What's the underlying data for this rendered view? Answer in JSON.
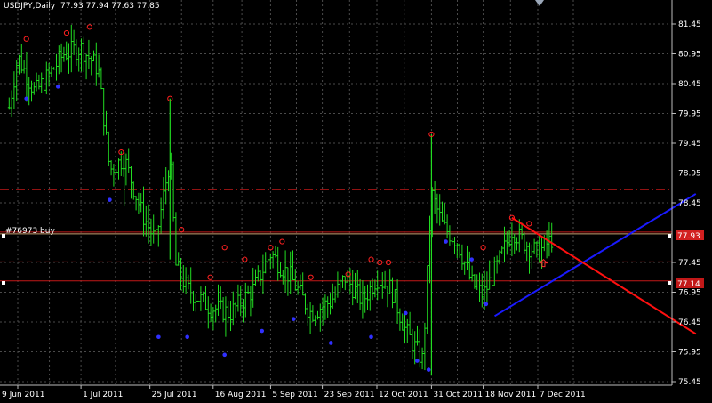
{
  "header": {
    "symbol_timeframe": "USDJPY,Daily",
    "ohlc": "77.93 77.94 77.63 77.85"
  },
  "order_label": "#76973 buy",
  "price_tags": {
    "upper": "77.93",
    "lower": "77.14"
  },
  "y_axis_labels": [
    "81.45",
    "80.95",
    "80.45",
    "79.95",
    "79.45",
    "78.95",
    "78.45",
    "77.45",
    "76.95",
    "76.45",
    "75.95",
    "75.45"
  ],
  "x_axis_labels": [
    "9 Jun 2011",
    "1 Jul 2011",
    "25 Jul 2011",
    "16 Aug 2011",
    "5 Sep 2011",
    "23 Sep 2011",
    "12 Oct 2011",
    "31 Oct 2011",
    "18 Nov 2011",
    "7 Dec 2011"
  ],
  "colors": {
    "background": "#000000",
    "bars": "#22dd22",
    "grid": "#4a4a4a",
    "fractal_high": "#ff2020",
    "fractal_low": "#3030ff",
    "trend_up": "#1a1aff",
    "trend_down": "#ff1010",
    "order_line": "#d22020",
    "sl_tp_line": "#c21818"
  },
  "chart_data": {
    "type": "ohlc",
    "y_axis_labels": [
      81.45,
      80.95,
      80.45,
      79.95,
      79.45,
      78.95,
      78.45,
      77.45,
      76.95,
      76.45,
      75.95,
      75.45
    ],
    "ylim": [
      75.37,
      81.62
    ],
    "close_path": [
      {
        "date": "2011-06-06",
        "close": 80.05
      },
      {
        "date": "2011-06-09",
        "close": 80.9
      },
      {
        "date": "2011-06-15",
        "close": 80.3
      },
      {
        "date": "2011-06-20",
        "close": 80.6
      },
      {
        "date": "2011-06-25",
        "close": 80.95
      },
      {
        "date": "2011-07-01",
        "close": 81.05
      },
      {
        "date": "2011-07-07",
        "close": 80.7
      },
      {
        "date": "2011-07-11",
        "close": 79.0
      },
      {
        "date": "2011-07-16",
        "close": 79.2
      },
      {
        "date": "2011-07-22",
        "close": 78.3
      },
      {
        "date": "2011-07-27",
        "close": 77.8
      },
      {
        "date": "2011-08-01",
        "close": 79.2
      },
      {
        "date": "2011-08-03",
        "close": 77.4
      },
      {
        "date": "2011-08-07",
        "close": 77.0
      },
      {
        "date": "2011-08-15",
        "close": 76.7
      },
      {
        "date": "2011-08-22",
        "close": 76.6
      },
      {
        "date": "2011-08-30",
        "close": 77.0
      },
      {
        "date": "2011-09-05",
        "close": 77.6
      },
      {
        "date": "2011-09-12",
        "close": 77.2
      },
      {
        "date": "2011-09-19",
        "close": 76.6
      },
      {
        "date": "2011-09-26",
        "close": 76.8
      },
      {
        "date": "2011-10-01",
        "close": 77.2
      },
      {
        "date": "2011-10-07",
        "close": 76.8
      },
      {
        "date": "2011-10-12",
        "close": 77.2
      },
      {
        "date": "2011-10-17",
        "close": 77.0
      },
      {
        "date": "2011-10-22",
        "close": 76.3
      },
      {
        "date": "2011-10-28",
        "close": 75.8
      },
      {
        "date": "2011-10-31",
        "close": 78.6
      },
      {
        "date": "2011-11-04",
        "close": 78.05
      },
      {
        "date": "2011-11-09",
        "close": 77.8
      },
      {
        "date": "2011-11-14",
        "close": 77.1
      },
      {
        "date": "2011-11-18",
        "close": 76.9
      },
      {
        "date": "2011-11-23",
        "close": 77.4
      },
      {
        "date": "2011-11-28",
        "close": 78.0
      },
      {
        "date": "2011-12-02",
        "close": 77.8
      },
      {
        "date": "2011-12-07",
        "close": 77.6
      },
      {
        "date": "2011-12-12",
        "close": 77.85
      }
    ],
    "fractals_high": [
      {
        "date": "2011-06-12",
        "price": 81.2
      },
      {
        "date": "2011-06-26",
        "price": 81.3
      },
      {
        "date": "2011-07-04",
        "price": 81.4
      },
      {
        "date": "2011-07-15",
        "price": 79.3
      },
      {
        "date": "2011-08-01",
        "price": 80.2
      },
      {
        "date": "2011-08-05",
        "price": 78.0
      },
      {
        "date": "2011-08-15",
        "price": 77.2
      },
      {
        "date": "2011-08-20",
        "price": 77.7
      },
      {
        "date": "2011-08-27",
        "price": 77.5
      },
      {
        "date": "2011-09-05",
        "price": 77.7
      },
      {
        "date": "2011-09-09",
        "price": 77.8
      },
      {
        "date": "2011-09-19",
        "price": 77.2
      },
      {
        "date": "2011-10-02",
        "price": 77.25
      },
      {
        "date": "2011-10-10",
        "price": 77.5
      },
      {
        "date": "2011-10-13",
        "price": 77.45
      },
      {
        "date": "2011-10-16",
        "price": 77.45
      },
      {
        "date": "2011-10-31",
        "price": 79.6
      },
      {
        "date": "2011-11-18",
        "price": 77.7
      },
      {
        "date": "2011-11-28",
        "price": 78.2
      },
      {
        "date": "2011-12-04",
        "price": 78.1
      }
    ],
    "fractals_low": [
      {
        "date": "2011-06-12",
        "price": 80.2
      },
      {
        "date": "2011-06-23",
        "price": 80.4
      },
      {
        "date": "2011-07-11",
        "price": 78.5
      },
      {
        "date": "2011-07-28",
        "price": 76.2
      },
      {
        "date": "2011-08-07",
        "price": 76.2
      },
      {
        "date": "2011-08-20",
        "price": 75.9
      },
      {
        "date": "2011-09-02",
        "price": 76.3
      },
      {
        "date": "2011-09-13",
        "price": 76.5
      },
      {
        "date": "2011-09-26",
        "price": 76.1
      },
      {
        "date": "2011-10-10",
        "price": 76.2
      },
      {
        "date": "2011-10-22",
        "price": 76.6
      },
      {
        "date": "2011-10-26",
        "price": 75.8
      },
      {
        "date": "2011-10-30",
        "price": 75.65
      },
      {
        "date": "2011-11-05",
        "price": 77.8
      },
      {
        "date": "2011-11-14",
        "price": 77.5
      },
      {
        "date": "2011-11-19",
        "price": 76.75
      }
    ],
    "horizontal_levels": [
      {
        "price": 78.67,
        "style": "dashdot"
      },
      {
        "price": 77.96,
        "style": "solid"
      },
      {
        "price": 77.93,
        "style": "order"
      },
      {
        "price": 77.46,
        "style": "dashed"
      },
      {
        "price": 77.14,
        "style": "solid"
      }
    ],
    "trendlines": [
      {
        "name": "support",
        "from": {
          "date": "2011-11-22",
          "price": 76.55
        },
        "to": {
          "date": "2012-01-31",
          "price": 78.6
        }
      },
      {
        "name": "resistance",
        "from": {
          "date": "2011-11-28",
          "price": 78.2
        },
        "to": {
          "date": "2012-01-31",
          "price": 76.25
        }
      }
    ],
    "buy_arrow": {
      "date": "2011-12-09",
      "price": 77.5
    }
  }
}
